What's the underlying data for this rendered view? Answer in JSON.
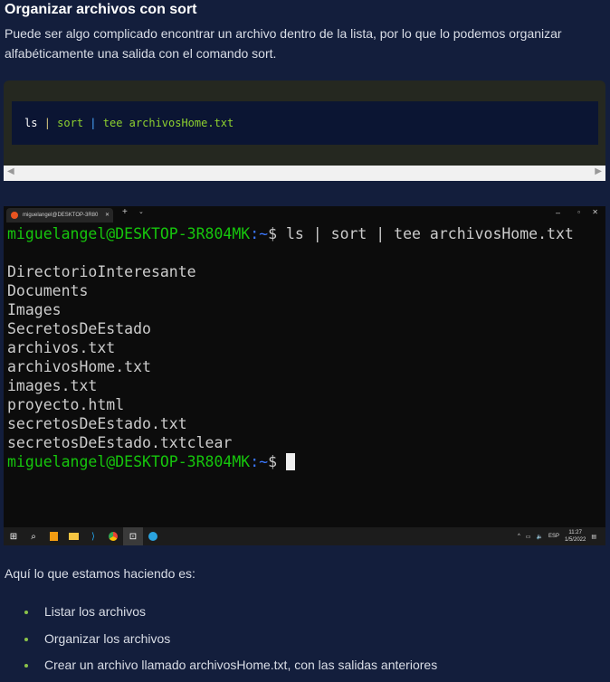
{
  "title": "Organizar archivos con sort",
  "paragraph": "Puede ser algo complicado encontrar un archivo dentro de la lista, por lo que lo podemos organizar alfabéticamente una salida con el comando sort.",
  "code": {
    "ls": "ls",
    "pipe": "|",
    "sort": "sort",
    "tee": "tee archivosHome.txt"
  },
  "terminal": {
    "tab_title": "miguelangel@DESKTOP-3R80",
    "prompt_user": "miguelangel@DESKTOP-3R804MK",
    "prompt_path": ":~",
    "prompt_sign": "$",
    "command": " ls | sort | tee archivosHome.txt",
    "output": [
      "DirectorioInteresante",
      "Documents",
      "Images",
      "SecretosDeEstado",
      "archivos.txt",
      "archivosHome.txt",
      "images.txt",
      "proyecto.html",
      "secretosDeEstado.txt",
      "secretosDeEstado.txtclear"
    ]
  },
  "taskbar": {
    "lang": "ESP",
    "time": "11:27",
    "date": "1/5/2022"
  },
  "intro": "Aquí lo que estamos haciendo es:",
  "steps": [
    "Listar los archivos",
    "Organizar los archivos",
    "Crear un archivo llamado archivosHome.txt, con las salidas anteriores"
  ]
}
